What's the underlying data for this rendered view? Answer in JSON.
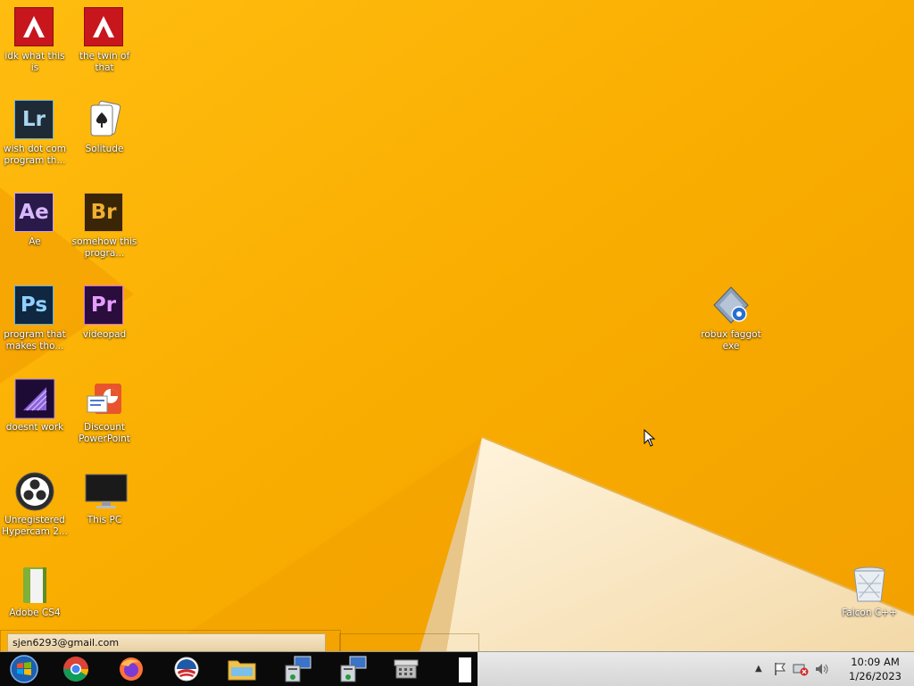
{
  "desktop": {
    "icons": [
      {
        "name": "pdf-app-1",
        "label": "idk what this is",
        "glyph": "A"
      },
      {
        "name": "pdf-app-2",
        "label": "the twin of that",
        "glyph": "A"
      },
      {
        "name": "lightroom",
        "label": "wish dot com program th...",
        "glyph": "Lr"
      },
      {
        "name": "solitaire",
        "label": "Solitude",
        "glyph": ""
      },
      {
        "name": "after-effects",
        "label": "Ae",
        "glyph": "Ae"
      },
      {
        "name": "bridge",
        "label": "somehow this progra...",
        "glyph": "Br"
      },
      {
        "name": "photoshop",
        "label": "program that makes tho...",
        "glyph": "Ps"
      },
      {
        "name": "premiere",
        "label": "videopad",
        "glyph": "Pr"
      },
      {
        "name": "media-encoder",
        "label": "doesnt work",
        "glyph": ""
      },
      {
        "name": "powerpoint",
        "label": "Discount PowerPoint",
        "glyph": ""
      },
      {
        "name": "obs",
        "label": "Unregistered Hypercam 2...",
        "glyph": ""
      },
      {
        "name": "this-pc",
        "label": "This PC",
        "glyph": ""
      },
      {
        "name": "adobe-cs4",
        "label": "Adobe CS4",
        "glyph": ""
      },
      {
        "name": "robux-exe",
        "label": "robux faggot exe",
        "glyph": ""
      },
      {
        "name": "recycle-bin",
        "label": "Falcon C++",
        "glyph": ""
      }
    ]
  },
  "overlay": {
    "email": "sjen6293@gmail.com"
  },
  "taskbar": {
    "items": [
      "start-button",
      "chrome",
      "firefox",
      "obama-app",
      "file-explorer",
      "network-app-1",
      "network-app-2",
      "cash-register-app"
    ],
    "clock": {
      "time": "10:09 AM",
      "date": "1/26/2023"
    }
  },
  "colors": {
    "wallpaper": "#f7b000",
    "taskbar": "#dcdcdc",
    "taskbar_dark": "#0a0a0a"
  }
}
